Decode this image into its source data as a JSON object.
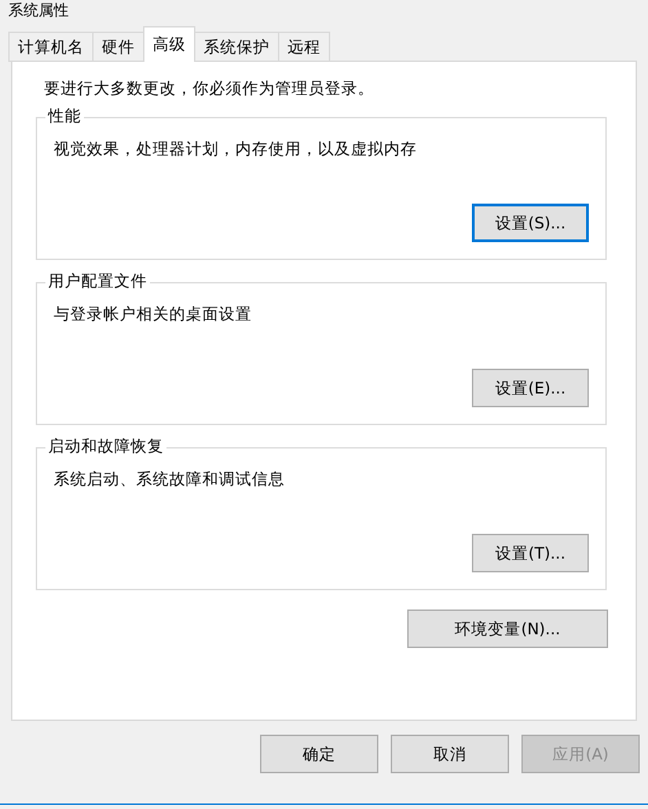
{
  "window": {
    "title": "系统属性"
  },
  "tabs": [
    {
      "label": "计算机名",
      "selected": false
    },
    {
      "label": "硬件",
      "selected": false
    },
    {
      "label": "高级",
      "selected": true
    },
    {
      "label": "系统保护",
      "selected": false
    },
    {
      "label": "远程",
      "selected": false
    }
  ],
  "notice": "要进行大多数更改，你必须作为管理员登录。",
  "groups": [
    {
      "title": "性能",
      "description": "视觉效果，处理器计划，内存使用，以及虚拟内存",
      "button": {
        "label": "设置(S)...",
        "focused": true
      }
    },
    {
      "title": "用户配置文件",
      "description": "与登录帐户相关的桌面设置",
      "button": {
        "label": "设置(E)...",
        "focused": false
      }
    },
    {
      "title": "启动和故障恢复",
      "description": "系统启动、系统故障和调试信息",
      "button": {
        "label": "设置(T)...",
        "focused": false
      }
    }
  ],
  "env_button": {
    "label": "环境变量(N)..."
  },
  "buttons": [
    {
      "label": "确定",
      "disabled": false
    },
    {
      "label": "取消",
      "disabled": false
    },
    {
      "label": "应用(A)",
      "disabled": true
    }
  ]
}
